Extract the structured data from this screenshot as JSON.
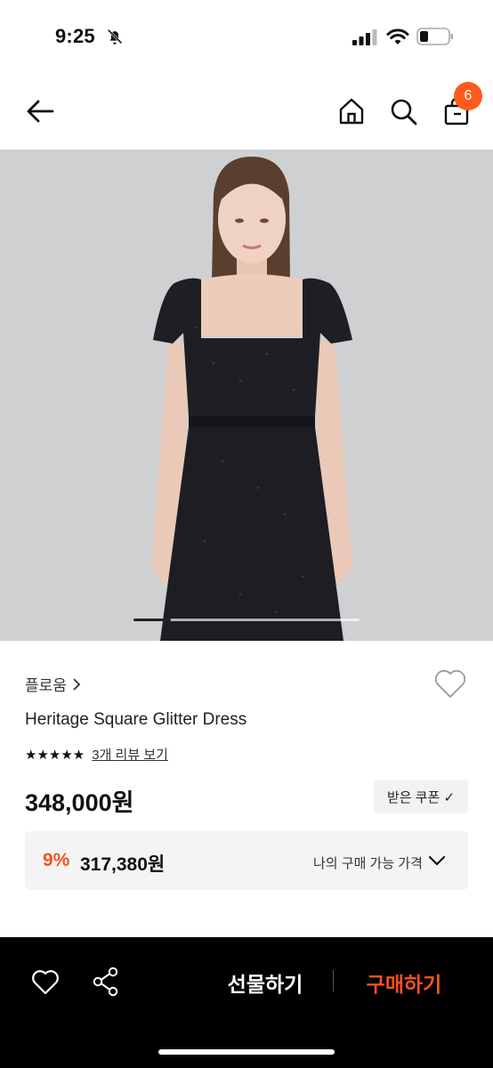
{
  "status_bar": {
    "time": "9:25",
    "icons": [
      "bell-slash-icon",
      "signal-icon",
      "wifi-icon",
      "battery-icon"
    ]
  },
  "header": {
    "icons": [
      "back-arrow-icon",
      "home-icon",
      "search-icon",
      "shopping-bag-icon"
    ],
    "cart_count": "6",
    "badge_color": "#ff5a1a"
  },
  "product": {
    "brand": "플로움",
    "name": "Heritage Square Glitter Dress",
    "stars": "★★★★★",
    "review_link": "3개 리뷰 보기",
    "price": "348,000원",
    "coupon_label": "받은 쿠폰 ✓",
    "discount_rate": "9%",
    "final_price": "317,380원",
    "my_price_label": "나의 구매 가능 가격"
  },
  "carousel": {
    "current": 1,
    "total": 6
  },
  "bottom_bar": {
    "gift_label": "선물하기",
    "buy_label": "구매하기",
    "icons": [
      "heart-icon",
      "share-icon"
    ],
    "accent_color": "#f4511e"
  }
}
